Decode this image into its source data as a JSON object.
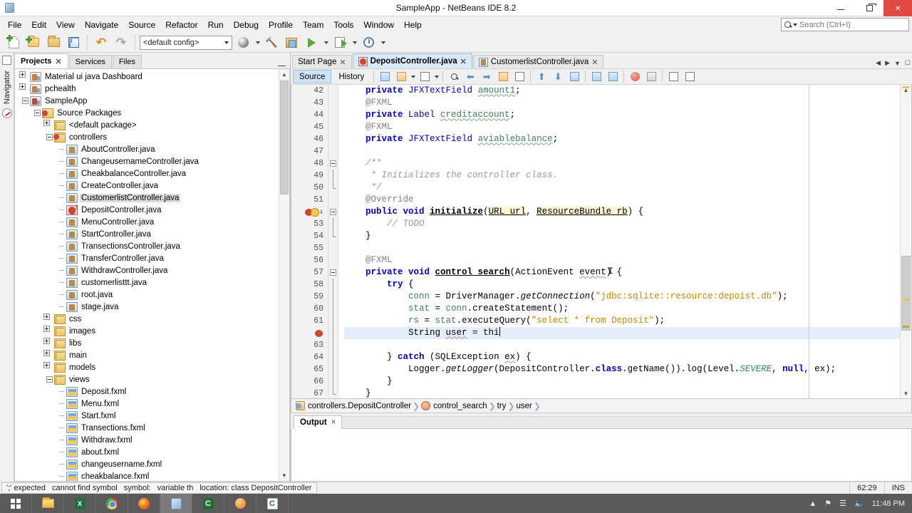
{
  "window": {
    "title": "SampleApp - NetBeans IDE 8.2",
    "app_icon": "cube-icon",
    "minimize": "–",
    "maximize": "❐",
    "close": "×"
  },
  "menubar": {
    "items": [
      "File",
      "Edit",
      "View",
      "Navigate",
      "Source",
      "Refactor",
      "Run",
      "Debug",
      "Profile",
      "Team",
      "Tools",
      "Window",
      "Help"
    ]
  },
  "search": {
    "placeholder": "Search (Ctrl+I)",
    "value": "",
    "icon": "search-icon"
  },
  "toolbar": {
    "config_value": "<default config>",
    "buttons": [
      {
        "name": "new-file-button",
        "icon": "new-file-icon"
      },
      {
        "name": "new-project-button",
        "icon": "new-project-icon"
      },
      {
        "name": "open-project-button",
        "icon": "open-project-icon"
      },
      {
        "name": "save-all-button",
        "icon": "save-all-icon"
      },
      {
        "name": "undo-button",
        "icon": "undo-icon"
      },
      {
        "name": "redo-button",
        "icon": "redo-icon"
      },
      {
        "name": "build-project-button",
        "icon": "build-icon"
      },
      {
        "name": "clean-build-button",
        "icon": "hammer-icon"
      },
      {
        "name": "clean-project-button",
        "icon": "clean-icon"
      },
      {
        "name": "run-project-button",
        "icon": "run-icon"
      },
      {
        "name": "debug-project-button",
        "icon": "debug-icon"
      },
      {
        "name": "profile-project-button",
        "icon": "profile-icon"
      }
    ]
  },
  "rail": {
    "label": "Navigator",
    "icons": [
      "window-icon",
      "compass-icon"
    ]
  },
  "projects_panel": {
    "tabs": [
      {
        "label": "Projects",
        "active": true,
        "closable": true
      },
      {
        "label": "Services",
        "active": false,
        "closable": false
      },
      {
        "label": "Files",
        "active": false,
        "closable": false
      }
    ],
    "minimize": "minimize-icon",
    "tree": [
      {
        "label": "Material ui java Dashboard",
        "depth": 0,
        "icon": "project-icon",
        "expander": "plus",
        "selected": false
      },
      {
        "label": "pchealth",
        "depth": 0,
        "icon": "project-icon",
        "expander": "plus",
        "selected": false
      },
      {
        "label": "SampleApp",
        "depth": 0,
        "icon": "project-error-icon",
        "expander": "minus",
        "selected": false
      },
      {
        "label": "Source Packages",
        "depth": 1,
        "icon": "source-packages-icon",
        "expander": "minus",
        "selected": false
      },
      {
        "label": "<default package>",
        "depth": 2,
        "icon": "package-icon",
        "expander": "plus",
        "selected": false
      },
      {
        "label": "controllers",
        "depth": 2,
        "icon": "package-error-icon",
        "expander": "minus",
        "selected": false
      },
      {
        "label": "AboutController.java",
        "depth": 3,
        "icon": "java-file-icon",
        "expander": "none",
        "selected": false
      },
      {
        "label": "ChangeusernameController.java",
        "depth": 3,
        "icon": "java-file-icon",
        "expander": "none",
        "selected": false
      },
      {
        "label": "CheakbalanceController.java",
        "depth": 3,
        "icon": "java-file-icon",
        "expander": "none",
        "selected": false
      },
      {
        "label": "CreateController.java",
        "depth": 3,
        "icon": "java-file-icon",
        "expander": "none",
        "selected": false
      },
      {
        "label": "CustomerlistController.java",
        "depth": 3,
        "icon": "java-file-icon",
        "expander": "none",
        "selected": true
      },
      {
        "label": "DepositController.java",
        "depth": 3,
        "icon": "java-file-error-icon",
        "expander": "none",
        "selected": false
      },
      {
        "label": "MenuController.java",
        "depth": 3,
        "icon": "java-file-icon",
        "expander": "none",
        "selected": false
      },
      {
        "label": "StartController.java",
        "depth": 3,
        "icon": "java-file-icon",
        "expander": "none",
        "selected": false
      },
      {
        "label": "TransectionsController.java",
        "depth": 3,
        "icon": "java-file-icon",
        "expander": "none",
        "selected": false
      },
      {
        "label": "TransferController.java",
        "depth": 3,
        "icon": "java-file-icon",
        "expander": "none",
        "selected": false
      },
      {
        "label": "WithdrawController.java",
        "depth": 3,
        "icon": "java-file-icon",
        "expander": "none",
        "selected": false
      },
      {
        "label": "customerlisttt.java",
        "depth": 3,
        "icon": "java-file-icon",
        "expander": "none",
        "selected": false
      },
      {
        "label": "root.java",
        "depth": 3,
        "icon": "java-file-icon",
        "expander": "none",
        "selected": false
      },
      {
        "label": "stage.java",
        "depth": 3,
        "icon": "java-file-icon",
        "expander": "none",
        "selected": false
      },
      {
        "label": "css",
        "depth": 2,
        "icon": "package-icon",
        "expander": "plus",
        "selected": false
      },
      {
        "label": "images",
        "depth": 2,
        "icon": "package-icon",
        "expander": "plus",
        "selected": false
      },
      {
        "label": "libs",
        "depth": 2,
        "icon": "package-icon",
        "expander": "plus",
        "selected": false
      },
      {
        "label": "main",
        "depth": 2,
        "icon": "package-icon",
        "expander": "plus",
        "selected": false
      },
      {
        "label": "models",
        "depth": 2,
        "icon": "package-icon",
        "expander": "plus",
        "selected": false
      },
      {
        "label": "views",
        "depth": 2,
        "icon": "package-icon",
        "expander": "minus",
        "selected": false
      },
      {
        "label": "Deposit.fxml",
        "depth": 3,
        "icon": "fxml-file-icon",
        "expander": "none",
        "selected": false
      },
      {
        "label": "Menu.fxml",
        "depth": 3,
        "icon": "fxml-file-icon",
        "expander": "none",
        "selected": false
      },
      {
        "label": "Start.fxml",
        "depth": 3,
        "icon": "fxml-file-icon",
        "expander": "none",
        "selected": false
      },
      {
        "label": "Transections.fxml",
        "depth": 3,
        "icon": "fxml-file-icon",
        "expander": "none",
        "selected": false
      },
      {
        "label": "Withdraw.fxml",
        "depth": 3,
        "icon": "fxml-file-icon",
        "expander": "none",
        "selected": false
      },
      {
        "label": "about.fxml",
        "depth": 3,
        "icon": "fxml-file-icon",
        "expander": "none",
        "selected": false
      },
      {
        "label": "changeusername.fxml",
        "depth": 3,
        "icon": "fxml-file-icon",
        "expander": "none",
        "selected": false
      },
      {
        "label": "cheakbalance.fxml",
        "depth": 3,
        "icon": "fxml-file-icon",
        "expander": "none",
        "selected": false
      }
    ]
  },
  "editor": {
    "tabs": [
      {
        "label": "Start Page",
        "icon": "none",
        "active": false,
        "closable": true
      },
      {
        "label": "DepositController.java",
        "icon": "java-error-icon",
        "active": true,
        "closable": true
      },
      {
        "label": "CustomerlistController.java",
        "icon": "java-icon",
        "active": false,
        "closable": true
      }
    ],
    "view_buttons": [
      {
        "label": "Source",
        "active": true
      },
      {
        "label": "History",
        "active": false
      }
    ],
    "lines": [
      {
        "num": "42",
        "indent": 4,
        "marker": "none",
        "fold": "none",
        "highlight": false,
        "tokens": [
          {
            "t": "private ",
            "c": "k"
          },
          {
            "t": "JFXTextField ",
            "c": "kb"
          },
          {
            "t": "amount1",
            "c": "fldu"
          },
          {
            "t": ";",
            "c": ""
          }
        ]
      },
      {
        "num": "43",
        "indent": 4,
        "marker": "none",
        "fold": "none",
        "highlight": false,
        "tokens": [
          {
            "t": "@FXML",
            "c": "an"
          }
        ]
      },
      {
        "num": "44",
        "indent": 4,
        "marker": "none",
        "fold": "none",
        "highlight": false,
        "tokens": [
          {
            "t": "private ",
            "c": "k"
          },
          {
            "t": "Label ",
            "c": "kb"
          },
          {
            "t": "creditaccount",
            "c": "fldu"
          },
          {
            "t": ";",
            "c": ""
          }
        ]
      },
      {
        "num": "45",
        "indent": 4,
        "marker": "none",
        "fold": "none",
        "highlight": false,
        "tokens": [
          {
            "t": "@FXML",
            "c": "an"
          }
        ]
      },
      {
        "num": "46",
        "indent": 4,
        "marker": "none",
        "fold": "none",
        "highlight": false,
        "tokens": [
          {
            "t": "private ",
            "c": "k"
          },
          {
            "t": "JFXTextField ",
            "c": "kb"
          },
          {
            "t": "aviablebalance",
            "c": "fldu"
          },
          {
            "t": ";",
            "c": ""
          }
        ]
      },
      {
        "num": "47",
        "indent": 0,
        "marker": "none",
        "fold": "none",
        "highlight": false,
        "tokens": []
      },
      {
        "num": "48",
        "indent": 4,
        "marker": "none",
        "fold": "start",
        "highlight": false,
        "tokens": [
          {
            "t": "/**",
            "c": "cm"
          }
        ]
      },
      {
        "num": "49",
        "indent": 4,
        "marker": "none",
        "fold": "bar",
        "highlight": false,
        "tokens": [
          {
            "t": " * Initializes the controller class.",
            "c": "cm"
          }
        ]
      },
      {
        "num": "50",
        "indent": 4,
        "marker": "none",
        "fold": "end",
        "highlight": false,
        "tokens": [
          {
            "t": " */",
            "c": "cm"
          }
        ]
      },
      {
        "num": "51",
        "indent": 4,
        "marker": "none",
        "fold": "none",
        "highlight": false,
        "tokens": [
          {
            "t": "@Override",
            "c": "an"
          }
        ]
      },
      {
        "num": "52",
        "indent": 4,
        "marker": "override-error",
        "fold": "start",
        "highlight": false,
        "tokens": [
          {
            "t": "public ",
            "c": "k"
          },
          {
            "t": "void ",
            "c": "k"
          },
          {
            "t": "initialize",
            "c": "mthb"
          },
          {
            "t": "(",
            "c": ""
          },
          {
            "t": "URL url",
            "c": "param"
          },
          {
            "t": ", ",
            "c": ""
          },
          {
            "t": "ResourceBundle rb",
            "c": "param"
          },
          {
            "t": ") {",
            "c": ""
          }
        ]
      },
      {
        "num": "53",
        "indent": 8,
        "marker": "none",
        "fold": "bar",
        "highlight": false,
        "tokens": [
          {
            "t": "// TODO",
            "c": "cm"
          }
        ]
      },
      {
        "num": "54",
        "indent": 4,
        "marker": "none",
        "fold": "end",
        "highlight": false,
        "tokens": [
          {
            "t": "}",
            "c": ""
          }
        ]
      },
      {
        "num": "55",
        "indent": 0,
        "marker": "none",
        "fold": "none",
        "highlight": false,
        "tokens": []
      },
      {
        "num": "56",
        "indent": 4,
        "marker": "none",
        "fold": "none",
        "highlight": false,
        "tokens": [
          {
            "t": "@FXML",
            "c": "an"
          }
        ]
      },
      {
        "num": "57",
        "indent": 4,
        "marker": "none",
        "fold": "start",
        "highlight": false,
        "tokens": [
          {
            "t": "private ",
            "c": "k"
          },
          {
            "t": "void ",
            "c": "k"
          },
          {
            "t": "control_search",
            "c": "mthb"
          },
          {
            "t": "(ActionEvent ",
            "c": ""
          },
          {
            "t": "event",
            "c": "idw"
          },
          {
            "t": ") {",
            "c": ""
          }
        ]
      },
      {
        "num": "58",
        "indent": 8,
        "marker": "none",
        "fold": "bar",
        "highlight": false,
        "tokens": [
          {
            "t": "try",
            "c": "k"
          },
          {
            "t": " {",
            "c": ""
          }
        ]
      },
      {
        "num": "59",
        "indent": 12,
        "marker": "none",
        "fold": "bar",
        "highlight": false,
        "tokens": [
          {
            "t": "conn",
            "c": "fld"
          },
          {
            "t": " = DriverManager.",
            "c": ""
          },
          {
            "t": "getConnection",
            "c": "mth"
          },
          {
            "t": "(",
            "c": ""
          },
          {
            "t": "\"jdbc:sqlite::resource:depoist.db\"",
            "c": "st"
          },
          {
            "t": ");",
            "c": ""
          }
        ]
      },
      {
        "num": "60",
        "indent": 12,
        "marker": "none",
        "fold": "bar",
        "highlight": false,
        "tokens": [
          {
            "t": "stat",
            "c": "fld"
          },
          {
            "t": " = ",
            "c": ""
          },
          {
            "t": "conn",
            "c": "fld"
          },
          {
            "t": ".createStatement();",
            "c": ""
          }
        ]
      },
      {
        "num": "61",
        "indent": 12,
        "marker": "none",
        "fold": "bar",
        "highlight": false,
        "tokens": [
          {
            "t": "rs",
            "c": "fld"
          },
          {
            "t": " = ",
            "c": ""
          },
          {
            "t": "stat",
            "c": "fld"
          },
          {
            "t": ".executeQuery(",
            "c": ""
          },
          {
            "t": "\"select * from Deposit\"",
            "c": "st"
          },
          {
            "t": ");",
            "c": ""
          }
        ]
      },
      {
        "num": "",
        "indent": 12,
        "marker": "error",
        "fold": "bar",
        "highlight": true,
        "tokens": [
          {
            "t": "String ",
            "c": ""
          },
          {
            "t": "user",
            "c": "idw"
          },
          {
            "t": " = thi",
            "c": ""
          },
          {
            "t": "|",
            "c": "caret"
          }
        ]
      },
      {
        "num": "63",
        "indent": 0,
        "marker": "none",
        "fold": "bar",
        "highlight": false,
        "tokens": []
      },
      {
        "num": "64",
        "indent": 8,
        "marker": "none",
        "fold": "bar",
        "highlight": false,
        "tokens": [
          {
            "t": "} ",
            "c": ""
          },
          {
            "t": "catch",
            "c": "k"
          },
          {
            "t": " (SQLException ",
            "c": ""
          },
          {
            "t": "ex",
            "c": "idw"
          },
          {
            "t": ") {",
            "c": ""
          }
        ]
      },
      {
        "num": "65",
        "indent": 12,
        "marker": "none",
        "fold": "bar",
        "highlight": false,
        "tokens": [
          {
            "t": "Logger.",
            "c": ""
          },
          {
            "t": "getLogger",
            "c": "mth"
          },
          {
            "t": "(DepositController.",
            "c": ""
          },
          {
            "t": "class",
            "c": "k"
          },
          {
            "t": ".getName()).log(Level.",
            "c": ""
          },
          {
            "t": "SEVERE",
            "c": "greeni"
          },
          {
            "t": ", ",
            "c": ""
          },
          {
            "t": "null",
            "c": "k"
          },
          {
            "t": ", ex);",
            "c": ""
          }
        ]
      },
      {
        "num": "66",
        "indent": 8,
        "marker": "none",
        "fold": "bar",
        "highlight": false,
        "tokens": [
          {
            "t": "}",
            "c": ""
          }
        ]
      },
      {
        "num": "67",
        "indent": 4,
        "marker": "none",
        "fold": "end",
        "highlight": false,
        "tokens": [
          {
            "t": "}",
            "c": ""
          }
        ]
      }
    ]
  },
  "breadcrumb": {
    "items": [
      {
        "label": "controllers.DepositController",
        "icon": "class-icon"
      },
      {
        "label": "control_search",
        "icon": "method-icon"
      },
      {
        "label": "try",
        "icon": "none"
      },
      {
        "label": "user",
        "icon": "none"
      }
    ],
    "separator": "❯"
  },
  "output_panel": {
    "tab_label": "Output",
    "close": "×",
    "content": ""
  },
  "statusbar": {
    "messages": [
      "';' expected",
      "cannot find symbol",
      "symbol:",
      "variable th",
      "location: class DepositController"
    ],
    "caret_position": "62:29",
    "insert_mode": "INS"
  },
  "taskbar": {
    "items": [
      {
        "name": "start-button",
        "icon": "windows-logo-icon"
      },
      {
        "name": "file-explorer-button",
        "icon": "folder-icon"
      },
      {
        "name": "excel-button",
        "icon": "excel-icon",
        "glyph": "X"
      },
      {
        "name": "chrome-button",
        "icon": "chrome-icon"
      },
      {
        "name": "firefox-button",
        "icon": "firefox-icon"
      },
      {
        "name": "netbeans-button",
        "icon": "netbeans-icon",
        "active": true
      },
      {
        "name": "app-green-button",
        "icon": "c-green-icon",
        "glyph": "C"
      },
      {
        "name": "app-orange-button",
        "icon": "orange-circle-icon"
      },
      {
        "name": "app-white-button",
        "icon": "c-white-icon",
        "glyph": "C"
      }
    ],
    "tray": {
      "expand": "▲",
      "network": "◢",
      "volume": "🔈",
      "time": "11:48 PM"
    }
  }
}
